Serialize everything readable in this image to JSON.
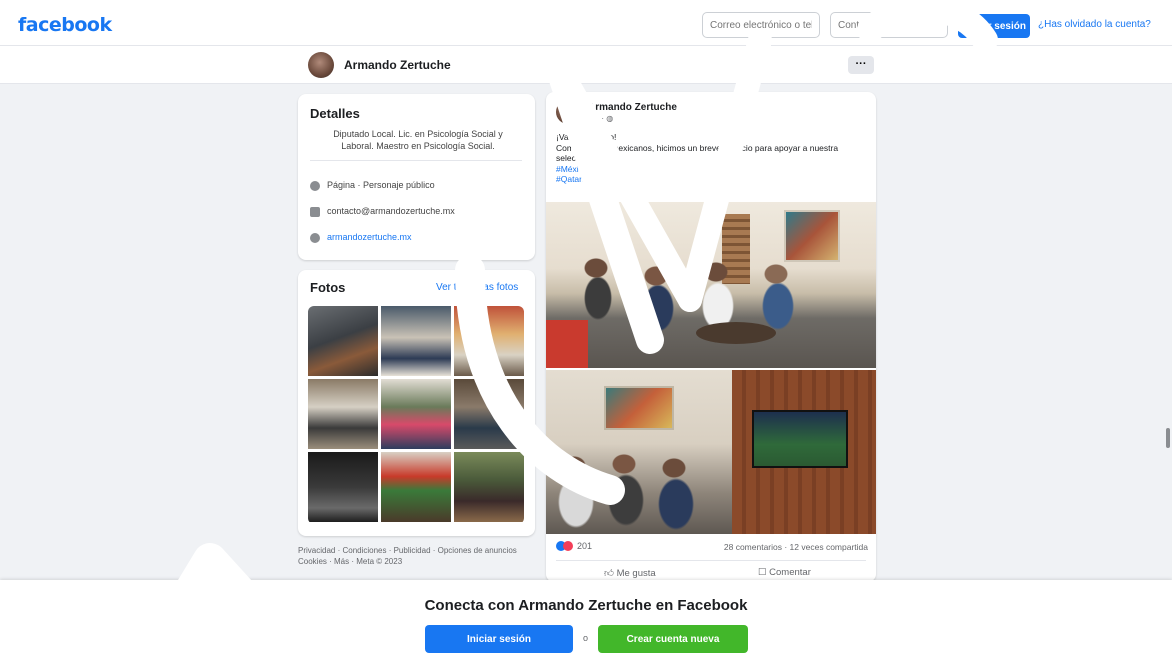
{
  "header": {
    "logo": "facebook",
    "email_placeholder": "Correo electrónico o tel",
    "password_placeholder": "Contraseña",
    "login_label": "Iniciar sesión",
    "forgot_label": "¿Has olvidado la cuenta?"
  },
  "profile": {
    "name": "Armando Zertuche",
    "more_label": "···"
  },
  "details": {
    "title": "Detalles",
    "bio": "Diputado Local. Lic. en Psicología Social y Laboral. Maestro en Psicología Social.",
    "page_type": "Página · Personaje público",
    "email": "contacto@armandozertuche.mx",
    "website": "armandozertuche.mx"
  },
  "photos": {
    "title": "Fotos",
    "see_all": "Ver todas las fotos"
  },
  "footer": {
    "links": "Privacidad · Condiciones · Publicidad · Opciones de anuncios",
    "copyright": "Cookies · Más · Meta © 2023"
  },
  "post": {
    "author": "Armando Zertuche",
    "date": "4 d · ◍",
    "text_line1": "¡Vamos México!",
    "text_line2": "Como buenos mexicanos, hicimos un breve espacio para apoyar a nuestra selección en su...",
    "hashtag1": "#MéxicoMiPasión",
    "hashtag2": "#Qatar2022",
    "reaction_count": "201",
    "counts": "28 comentarios · 12 veces compartida",
    "like_label": "Me gusta",
    "comment_label": "Comentar"
  },
  "banner": {
    "title": "Conecta con Armando Zertuche en Facebook",
    "login_label": "Iniciar sesión",
    "or_label": "o",
    "create_label": "Crear cuenta nueva"
  },
  "colors": {
    "brand_blue": "#1877f2",
    "create_green": "#42b72a",
    "background": "#f0f2f5"
  }
}
